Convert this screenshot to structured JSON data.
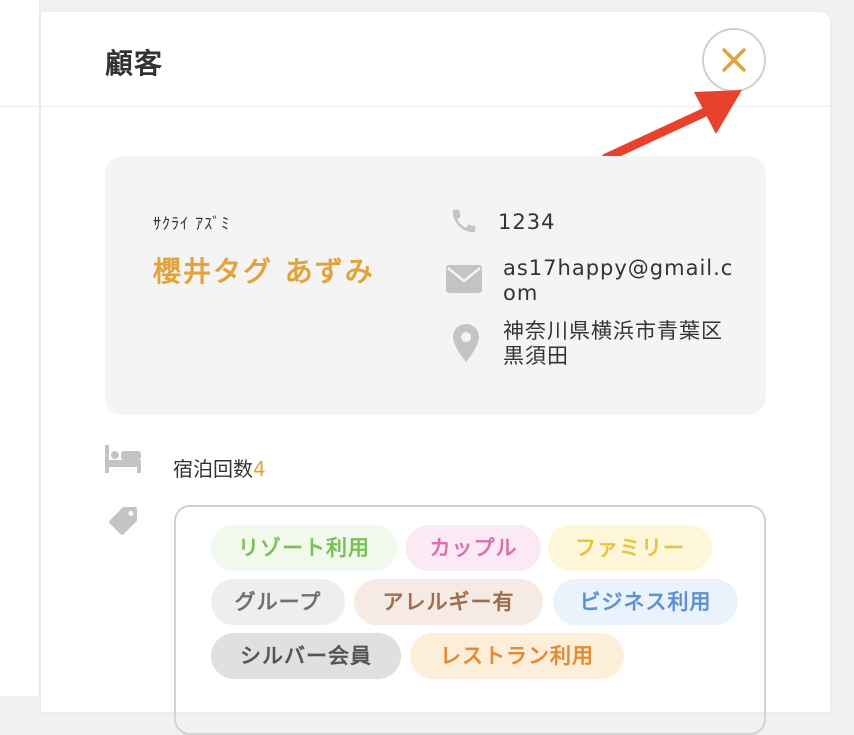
{
  "panel": {
    "title": "顧客",
    "close_icon": "close-x-icon"
  },
  "customer": {
    "kana": "ｻｸﾗｲ ｱｽﾞﾐ",
    "name": "櫻井タグ あずみ",
    "phone": "1234",
    "email": "as17happy@gmail.com",
    "address": "神奈川県横浜市青葉区黒須田"
  },
  "stays": {
    "label": "宿泊回数",
    "count": "4"
  },
  "tags": [
    {
      "label": "リゾート利用",
      "color": "#78c255",
      "bg": "#f1f9ec"
    },
    {
      "label": "カップル",
      "color": "#d872b0",
      "bg": "#fbe9f3"
    },
    {
      "label": "ファミリー",
      "color": "#e7c33e",
      "bg": "#fdf6d8"
    },
    {
      "label": "グループ",
      "color": "#6f6f6f",
      "bg": "#eeeeee"
    },
    {
      "label": "アレルギー有",
      "color": "#a06d4b",
      "bg": "#f5ebe4"
    },
    {
      "label": "ビジネス利用",
      "color": "#5e91d1",
      "bg": "#eaf2fb"
    },
    {
      "label": "シルバー会員",
      "color": "#555555",
      "bg": "#e0e0e0"
    },
    {
      "label": "レストラン利用",
      "color": "#e48a32",
      "bg": "#fdeed9"
    }
  ],
  "colors": {
    "accent": "#e0a43a",
    "annotation_arrow": "#e8412c",
    "icon_gray": "#c4c4c4"
  }
}
